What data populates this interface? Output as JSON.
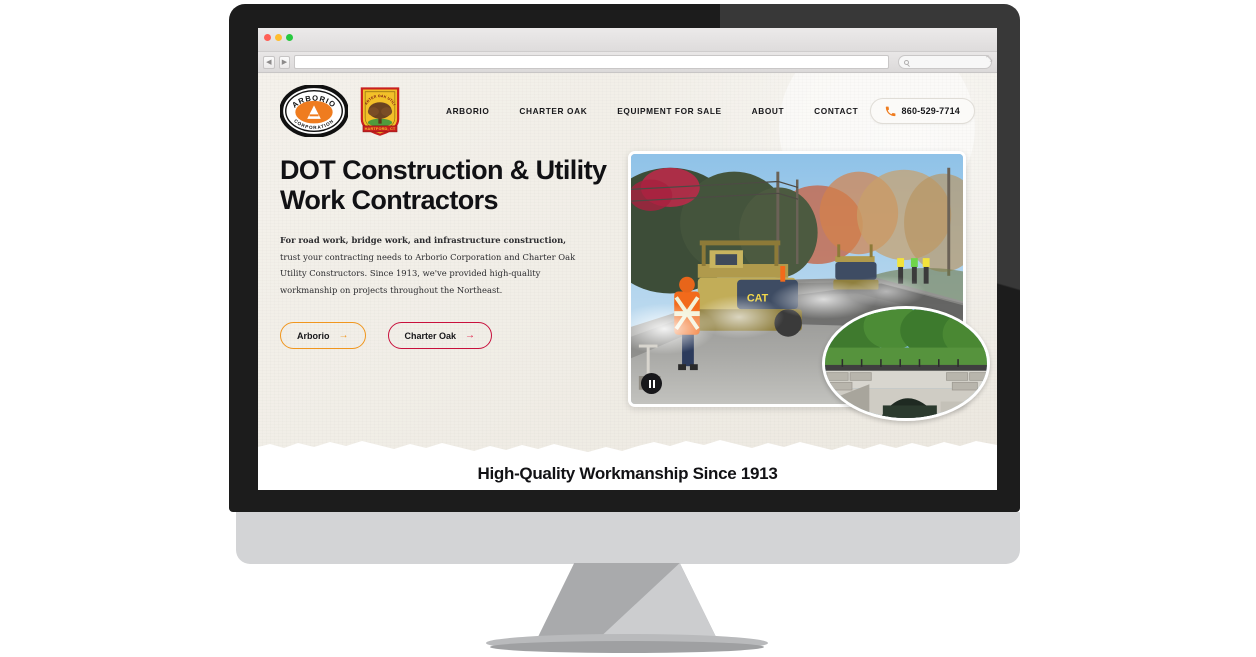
{
  "browser": {
    "url_placeholder": "",
    "search_placeholder": "",
    "back_glyph": "◀",
    "forward_glyph": "▶",
    "resize_glyph": "⤡"
  },
  "site": {
    "logos": {
      "arborio": {
        "top_text": "ARBORIO",
        "bottom_text": "CORPORATION",
        "letter": "A",
        "ring_color": "#111111",
        "ellipse_color": "#ef7c1f"
      },
      "charter_oak": {
        "arc_text": "CHARTER OAK UTILITY CONSTRUCTORS",
        "banner_text": "HARTFORD, CT",
        "badge_color": "#f2c029",
        "banner_color": "#c81f1f",
        "tree_color": "#6b4321",
        "grass_color": "#4f9b3c"
      }
    },
    "nav": [
      {
        "label": "ARBORIO"
      },
      {
        "label": "CHARTER OAK"
      },
      {
        "label": "EQUIPMENT FOR SALE"
      },
      {
        "label": "ABOUT"
      },
      {
        "label": "CONTACT"
      }
    ],
    "phone": {
      "number": "860-529-7714",
      "icon": "phone-icon",
      "icon_color": "#ef7c1f"
    }
  },
  "hero": {
    "title": "DOT Construction & Utility Work Contractors",
    "paragraph_lead": "For road work, bridge work, and infrastructure construction,",
    "paragraph_rest": " trust your contracting needs to Arborio Corporation and Charter Oak Utility Constructors. Since 1913, we've provided high-quality workmanship on projects throughout the Northeast.",
    "buttons": [
      {
        "label": "Arborio",
        "arrow": "→",
        "accent": "#f0961e"
      },
      {
        "label": "Charter Oak",
        "arrow": "→",
        "accent": "#c8103c"
      }
    ],
    "media": {
      "main_caption": "road paving crew with CAT roller on asphalt road in autumn",
      "inset_caption": "stone arch bridge culvert with trees",
      "player_state": "pause"
    },
    "background_color": "#f1eee7"
  },
  "tagline": {
    "text": "High-Quality Workmanship Since 1913"
  }
}
